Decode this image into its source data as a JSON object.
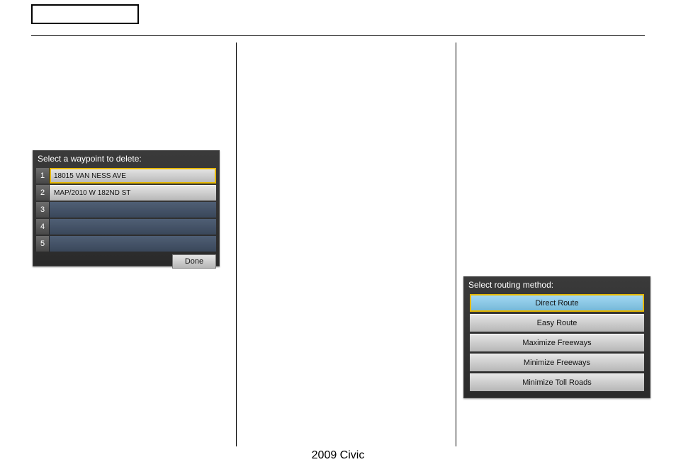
{
  "footer": {
    "label": "2009  Civic"
  },
  "waypoint_screen": {
    "title": "Select a waypoint to delete:",
    "rows": [
      {
        "n": "1",
        "label": "18015 VAN NESS AVE",
        "style": "metal",
        "selected": true
      },
      {
        "n": "2",
        "label": "MAP/2010 W 182ND ST",
        "style": "metal",
        "selected": false
      },
      {
        "n": "3",
        "label": "",
        "style": "empty",
        "selected": false
      },
      {
        "n": "4",
        "label": "",
        "style": "empty",
        "selected": false
      },
      {
        "n": "5",
        "label": "",
        "style": "empty",
        "selected": false
      }
    ],
    "done_label": "Done"
  },
  "routing_screen": {
    "title": "Select routing method:",
    "options": [
      {
        "label": "Direct Route",
        "active": true,
        "selected": true
      },
      {
        "label": "Easy Route",
        "active": false,
        "selected": false
      },
      {
        "label": "Maximize Freeways",
        "active": false,
        "selected": false
      },
      {
        "label": "Minimize Freeways",
        "active": false,
        "selected": false
      },
      {
        "label": "Minimize Toll Roads",
        "active": false,
        "selected": false
      }
    ]
  }
}
